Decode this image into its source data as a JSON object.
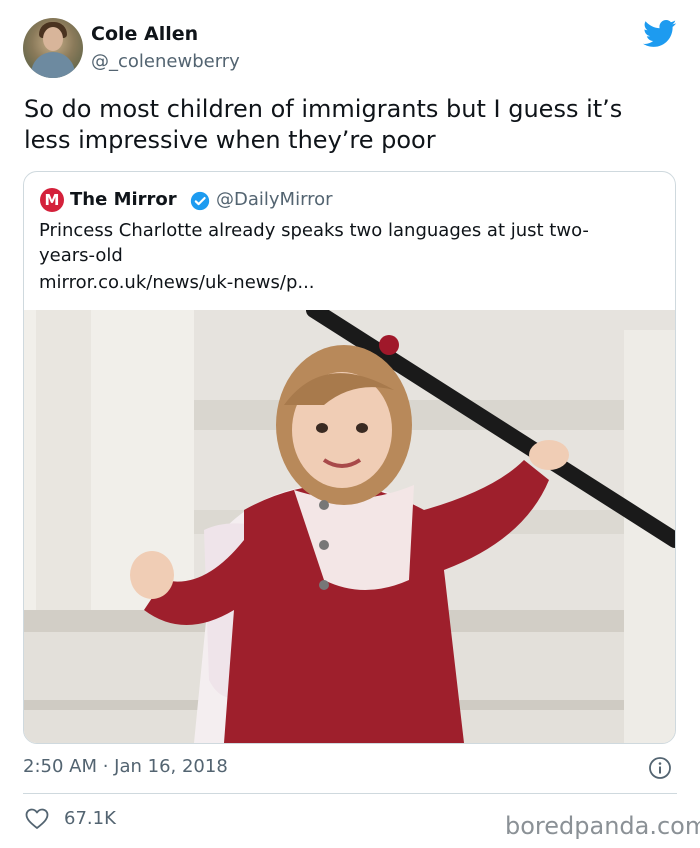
{
  "author": {
    "name": "Cole Allen",
    "handle": "@_colenewberry"
  },
  "tweet": {
    "text": "So do most children of immigrants but I guess it’s less impressive when they’re poor",
    "timestamp": "2:50 AM · Jan 16, 2018",
    "likes": "67.1K"
  },
  "quoted": {
    "logo_letter": "M",
    "name": "The Mirror",
    "handle": "@DailyMirror",
    "text": "Princess Charlotte already speaks two languages at just two-years-old",
    "link": "mirror.co.uk/news/uk-news/p..."
  },
  "watermark": "boredpanda.com",
  "colors": {
    "twitter_blue": "#1d9bf0",
    "mirror_red": "#d4213b",
    "secondary_text": "#536471"
  }
}
